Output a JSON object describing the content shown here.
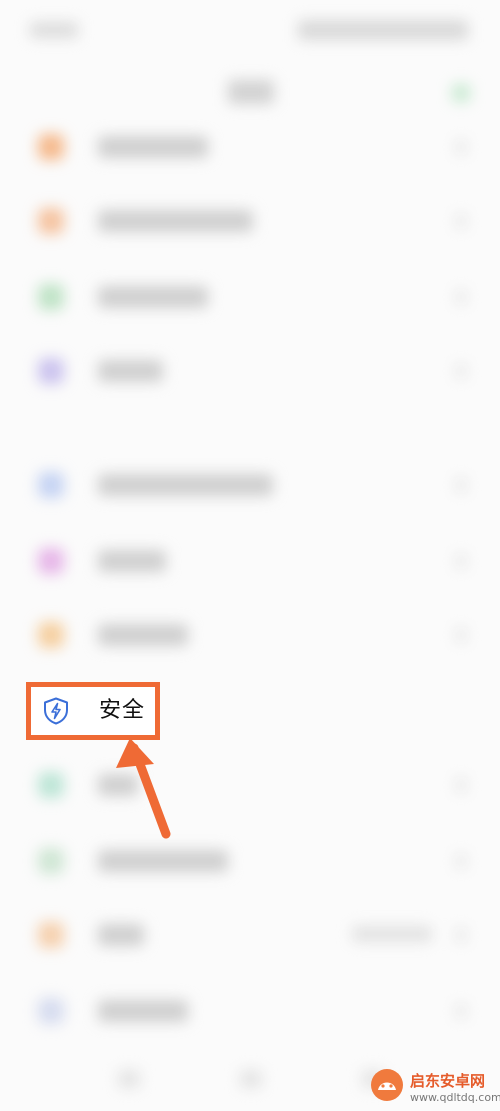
{
  "highlighted_item": {
    "label": "安全",
    "icon": "shield-lightning-icon"
  },
  "colors": {
    "highlight": "#ef6a35",
    "icon_blue": "#3b6fd8"
  },
  "watermark": {
    "line1": "启东安卓网",
    "line2": "www.qdltdq.com"
  }
}
